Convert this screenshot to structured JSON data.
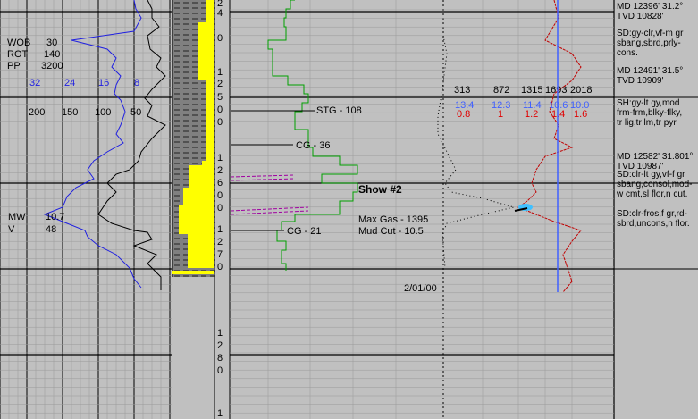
{
  "drilling_params": [
    {
      "label": "WOB",
      "value": "30"
    },
    {
      "label": "ROT",
      "value": "140"
    },
    {
      "label": "PP",
      "value": "3200"
    }
  ],
  "scale_blue": [
    "32",
    "24",
    "16",
    "8"
  ],
  "scale_black": [
    "200",
    "150",
    "100",
    "50"
  ],
  "mud_params": [
    {
      "label": "MW",
      "value": "10.7"
    },
    {
      "label": "V",
      "value": "48"
    }
  ],
  "depth_digits": [
    "2",
    "4",
    "0",
    "1",
    "2",
    "5",
    "0",
    "0",
    "1",
    "2",
    "6",
    "0",
    "0",
    "1",
    "2",
    "7",
    "0",
    "1",
    "2",
    "8",
    "0",
    "1"
  ],
  "gas_annotations": [
    {
      "text": "STG - 108"
    },
    {
      "text": "CG - 36"
    },
    {
      "text": "CG - 21"
    }
  ],
  "show_label": "Show #2",
  "show_details": [
    "Max Gas - 1395",
    "Mud Cut - 10.5"
  ],
  "date": "2/01/00",
  "chrom_headers": [
    "313",
    "872",
    "1315",
    "1693",
    "2018"
  ],
  "chrom_blue": [
    "13.4",
    "12.3",
    "11.4",
    "10.6",
    "10.0"
  ],
  "chrom_red": [
    "0.8",
    "1",
    "1.2",
    "1.4",
    "1.6"
  ],
  "descriptions": [
    [
      "MD 12396'  31.2°",
      "TVD 10828'"
    ],
    [
      "SD:gy-clr,vf-m gr",
      "sbang,sbrd,prly-",
      "cons."
    ],
    [
      "MD 12491'  31.5°",
      "TVD 10909'"
    ],
    [
      "SH:gy-lt gy,mod",
      "frm-frm,blky-flky,",
      "tr lig,tr lm,tr pyr."
    ],
    [
      "MD 12582'  31.801°",
      "TVD 10987'"
    ],
    [
      "SD:clr-lt gy,vf-f gr",
      "sbang,consol,mod-",
      "w cmt,sl flor,n cut."
    ],
    [
      "SD:clr-fros,f gr,rd-",
      "sbrd,uncons,n flor."
    ]
  ],
  "colors": {
    "blue": "#2020e0",
    "black": "#000000",
    "green": "#00a000",
    "red": "#c00000",
    "yellow": "#ffff00",
    "gray": "#808080",
    "magenta": "#a000a0",
    "cyan": "#40c0ff",
    "bg": "#c0c0c0"
  }
}
